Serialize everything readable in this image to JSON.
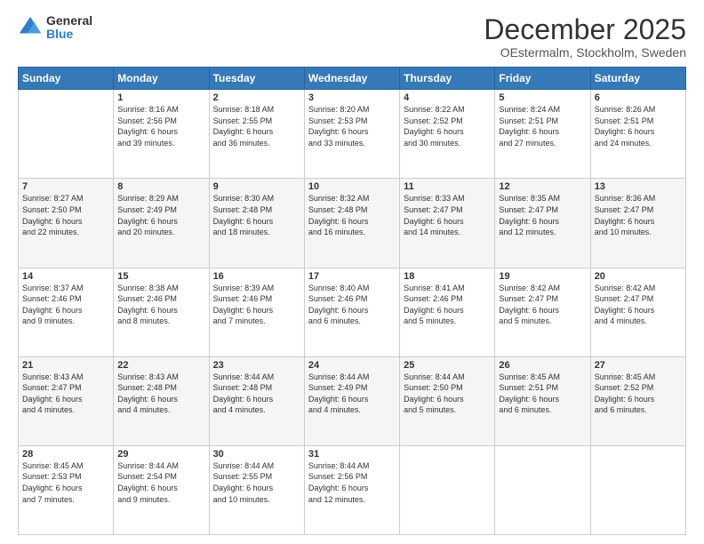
{
  "logo": {
    "general": "General",
    "blue": "Blue"
  },
  "header": {
    "title": "December 2025",
    "subtitle": "OEstermalm, Stockholm, Sweden"
  },
  "weekdays": [
    "Sunday",
    "Monday",
    "Tuesday",
    "Wednesday",
    "Thursday",
    "Friday",
    "Saturday"
  ],
  "weeks": [
    [
      {
        "day": "",
        "info": ""
      },
      {
        "day": "1",
        "info": "Sunrise: 8:16 AM\nSunset: 2:56 PM\nDaylight: 6 hours\nand 39 minutes."
      },
      {
        "day": "2",
        "info": "Sunrise: 8:18 AM\nSunset: 2:55 PM\nDaylight: 6 hours\nand 36 minutes."
      },
      {
        "day": "3",
        "info": "Sunrise: 8:20 AM\nSunset: 2:53 PM\nDaylight: 6 hours\nand 33 minutes."
      },
      {
        "day": "4",
        "info": "Sunrise: 8:22 AM\nSunset: 2:52 PM\nDaylight: 6 hours\nand 30 minutes."
      },
      {
        "day": "5",
        "info": "Sunrise: 8:24 AM\nSunset: 2:51 PM\nDaylight: 6 hours\nand 27 minutes."
      },
      {
        "day": "6",
        "info": "Sunrise: 8:26 AM\nSunset: 2:51 PM\nDaylight: 6 hours\nand 24 minutes."
      }
    ],
    [
      {
        "day": "7",
        "info": "Sunrise: 8:27 AM\nSunset: 2:50 PM\nDaylight: 6 hours\nand 22 minutes."
      },
      {
        "day": "8",
        "info": "Sunrise: 8:29 AM\nSunset: 2:49 PM\nDaylight: 6 hours\nand 20 minutes."
      },
      {
        "day": "9",
        "info": "Sunrise: 8:30 AM\nSunset: 2:48 PM\nDaylight: 6 hours\nand 18 minutes."
      },
      {
        "day": "10",
        "info": "Sunrise: 8:32 AM\nSunset: 2:48 PM\nDaylight: 6 hours\nand 16 minutes."
      },
      {
        "day": "11",
        "info": "Sunrise: 8:33 AM\nSunset: 2:47 PM\nDaylight: 6 hours\nand 14 minutes."
      },
      {
        "day": "12",
        "info": "Sunrise: 8:35 AM\nSunset: 2:47 PM\nDaylight: 6 hours\nand 12 minutes."
      },
      {
        "day": "13",
        "info": "Sunrise: 8:36 AM\nSunset: 2:47 PM\nDaylight: 6 hours\nand 10 minutes."
      }
    ],
    [
      {
        "day": "14",
        "info": "Sunrise: 8:37 AM\nSunset: 2:46 PM\nDaylight: 6 hours\nand 9 minutes."
      },
      {
        "day": "15",
        "info": "Sunrise: 8:38 AM\nSunset: 2:46 PM\nDaylight: 6 hours\nand 8 minutes."
      },
      {
        "day": "16",
        "info": "Sunrise: 8:39 AM\nSunset: 2:46 PM\nDaylight: 6 hours\nand 7 minutes."
      },
      {
        "day": "17",
        "info": "Sunrise: 8:40 AM\nSunset: 2:46 PM\nDaylight: 6 hours\nand 6 minutes."
      },
      {
        "day": "18",
        "info": "Sunrise: 8:41 AM\nSunset: 2:46 PM\nDaylight: 6 hours\nand 5 minutes."
      },
      {
        "day": "19",
        "info": "Sunrise: 8:42 AM\nSunset: 2:47 PM\nDaylight: 6 hours\nand 5 minutes."
      },
      {
        "day": "20",
        "info": "Sunrise: 8:42 AM\nSunset: 2:47 PM\nDaylight: 6 hours\nand 4 minutes."
      }
    ],
    [
      {
        "day": "21",
        "info": "Sunrise: 8:43 AM\nSunset: 2:47 PM\nDaylight: 6 hours\nand 4 minutes."
      },
      {
        "day": "22",
        "info": "Sunrise: 8:43 AM\nSunset: 2:48 PM\nDaylight: 6 hours\nand 4 minutes."
      },
      {
        "day": "23",
        "info": "Sunrise: 8:44 AM\nSunset: 2:48 PM\nDaylight: 6 hours\nand 4 minutes."
      },
      {
        "day": "24",
        "info": "Sunrise: 8:44 AM\nSunset: 2:49 PM\nDaylight: 6 hours\nand 4 minutes."
      },
      {
        "day": "25",
        "info": "Sunrise: 8:44 AM\nSunset: 2:50 PM\nDaylight: 6 hours\nand 5 minutes."
      },
      {
        "day": "26",
        "info": "Sunrise: 8:45 AM\nSunset: 2:51 PM\nDaylight: 6 hours\nand 6 minutes."
      },
      {
        "day": "27",
        "info": "Sunrise: 8:45 AM\nSunset: 2:52 PM\nDaylight: 6 hours\nand 6 minutes."
      }
    ],
    [
      {
        "day": "28",
        "info": "Sunrise: 8:45 AM\nSunset: 2:53 PM\nDaylight: 6 hours\nand 7 minutes."
      },
      {
        "day": "29",
        "info": "Sunrise: 8:44 AM\nSunset: 2:54 PM\nDaylight: 6 hours\nand 9 minutes."
      },
      {
        "day": "30",
        "info": "Sunrise: 8:44 AM\nSunset: 2:55 PM\nDaylight: 6 hours\nand 10 minutes."
      },
      {
        "day": "31",
        "info": "Sunrise: 8:44 AM\nSunset: 2:56 PM\nDaylight: 6 hours\nand 12 minutes."
      },
      {
        "day": "",
        "info": ""
      },
      {
        "day": "",
        "info": ""
      },
      {
        "day": "",
        "info": ""
      }
    ]
  ]
}
